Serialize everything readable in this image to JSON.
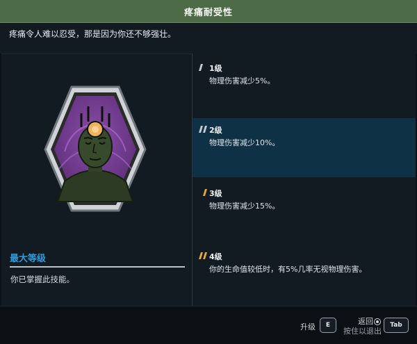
{
  "title": "疼痛耐受性",
  "description": "疼痛令人难以忍受，那是因为你还不够强壮。",
  "left": {
    "max_level_label": "最大等级",
    "mastered_text": "你已掌握此技能。",
    "emblem_icon": "meditating-figure-emblem-icon"
  },
  "tiers": [
    {
      "level": "1级",
      "desc": "物理伤害减少5%。",
      "marker_color": "#c4cbd0",
      "active": false
    },
    {
      "level": "2级",
      "desc": "物理伤害减少10%。",
      "marker_color": "#c4cbd0",
      "active": true
    },
    {
      "level": "3级",
      "desc": "物理伤害减少15%。",
      "marker_color": "#e3a73a",
      "active": false
    },
    {
      "level": "4级",
      "desc": "你的生命值较低时，有5%几率无视物理伤害。",
      "marker_color": "#e3a73a",
      "active": false
    }
  ],
  "footer": {
    "upgrade_label": "升级",
    "upgrade_key": "E",
    "back_label": "返回",
    "hold_exit_label": "按住以退出",
    "tab_key": "Tab"
  },
  "colors": {
    "title_bar": "#4e6b47",
    "accent_blue": "#2f9ad9",
    "active_row": "#0f3146",
    "marker_gold": "#e3a73a"
  }
}
